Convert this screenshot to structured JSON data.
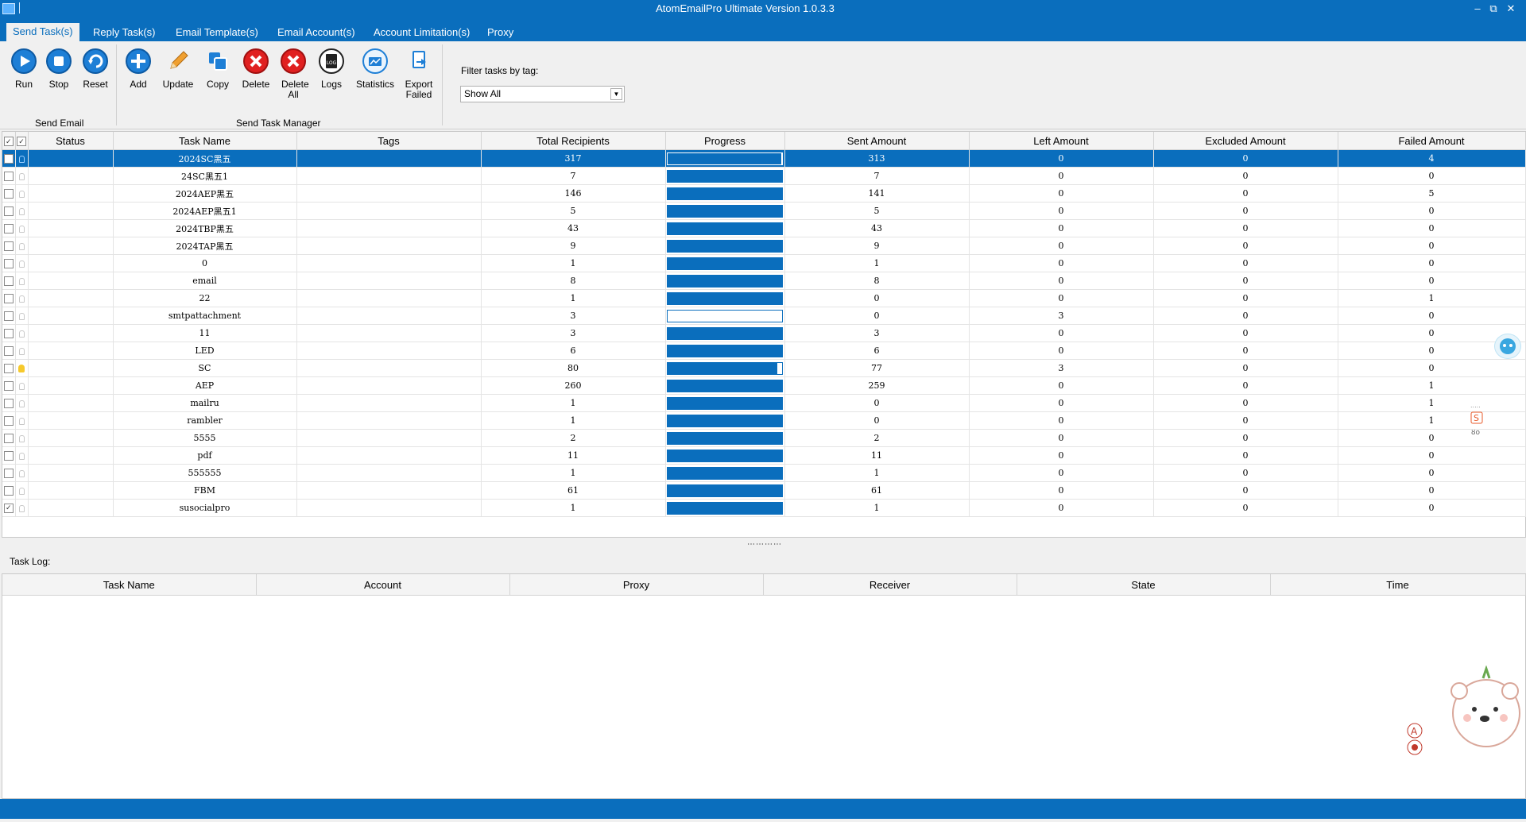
{
  "window": {
    "title": "AtomEmailPro Ultimate Version 1.0.3.3"
  },
  "tabs": [
    "Send Task(s)",
    "Reply Task(s)",
    "Email Template(s)",
    "Email Account(s)",
    "Account Limitation(s)",
    "Proxy"
  ],
  "ribbon": {
    "send_email": {
      "label": "Send Email",
      "buttons": [
        {
          "label": "Run",
          "icon": "play-icon",
          "color": "#1e7fd6"
        },
        {
          "label": "Stop",
          "icon": "stop-icon",
          "color": "#1e7fd6"
        },
        {
          "label": "Reset",
          "icon": "reset-icon",
          "color": "#1e7fd6"
        }
      ]
    },
    "task_manager": {
      "label": "Send Task Manager",
      "buttons": [
        {
          "label": "Add",
          "icon": "add-icon",
          "color": "#1e7fd6"
        },
        {
          "label": "Update",
          "icon": "pencil-icon",
          "color": "#f0a030"
        },
        {
          "label": "Copy",
          "icon": "copy-icon",
          "color": "#1e7fd6"
        },
        {
          "label": "Delete",
          "icon": "delete-icon",
          "color": "#e02020"
        },
        {
          "label": "Delete All",
          "icon": "delete-all-icon",
          "color": "#e02020"
        },
        {
          "label": "Logs",
          "icon": "log-icon",
          "color": "#222222"
        },
        {
          "label": "Statistics",
          "icon": "statistics-icon",
          "color": "#1e7fd6"
        },
        {
          "label": "Export Failed",
          "icon": "export-icon",
          "color": "#1e7fd6"
        }
      ]
    },
    "filter": {
      "label": "Filter tasks by tag:",
      "value": "Show All"
    }
  },
  "grid": {
    "columns": [
      "Status",
      "Task Name",
      "Tags",
      "Total Recipients",
      "Progress",
      "Sent Amount",
      "Left Amount",
      "Excluded Amount",
      "Failed Amount"
    ],
    "rows": [
      {
        "name": "2024SC黑五",
        "tags": "",
        "total": "317",
        "progress": 0.99,
        "sent": "313",
        "left": "0",
        "excluded": "0",
        "failed": "4",
        "selected": true,
        "checked": false,
        "bulb": "dim"
      },
      {
        "name": "24SC黑五1",
        "tags": "",
        "total": "7",
        "progress": 1,
        "sent": "7",
        "left": "0",
        "excluded": "0",
        "failed": "0",
        "selected": false,
        "checked": false,
        "bulb": "dim"
      },
      {
        "name": "2024AEP黑五",
        "tags": "",
        "total": "146",
        "progress": 1,
        "sent": "141",
        "left": "0",
        "excluded": "0",
        "failed": "5",
        "selected": false,
        "checked": false,
        "bulb": "dim"
      },
      {
        "name": "2024AEP黑五1",
        "tags": "",
        "total": "5",
        "progress": 1,
        "sent": "5",
        "left": "0",
        "excluded": "0",
        "failed": "0",
        "selected": false,
        "checked": false,
        "bulb": "dim"
      },
      {
        "name": "2024TBP黑五",
        "tags": "",
        "total": "43",
        "progress": 1,
        "sent": "43",
        "left": "0",
        "excluded": "0",
        "failed": "0",
        "selected": false,
        "checked": false,
        "bulb": "dim"
      },
      {
        "name": "2024TAP黑五",
        "tags": "",
        "total": "9",
        "progress": 1,
        "sent": "9",
        "left": "0",
        "excluded": "0",
        "failed": "0",
        "selected": false,
        "checked": false,
        "bulb": "dim"
      },
      {
        "name": "0",
        "tags": "",
        "total": "1",
        "progress": 1,
        "sent": "1",
        "left": "0",
        "excluded": "0",
        "failed": "0",
        "selected": false,
        "checked": false,
        "bulb": "dim"
      },
      {
        "name": "email",
        "tags": "",
        "total": "8",
        "progress": 1,
        "sent": "8",
        "left": "0",
        "excluded": "0",
        "failed": "0",
        "selected": false,
        "checked": false,
        "bulb": "dim"
      },
      {
        "name": "22",
        "tags": "",
        "total": "1",
        "progress": 1,
        "sent": "0",
        "left": "0",
        "excluded": "0",
        "failed": "1",
        "selected": false,
        "checked": false,
        "bulb": "dim"
      },
      {
        "name": "smtpattachment",
        "tags": "",
        "total": "3",
        "progress": 0,
        "sent": "0",
        "left": "3",
        "excluded": "0",
        "failed": "0",
        "selected": false,
        "checked": false,
        "bulb": "dim"
      },
      {
        "name": "11",
        "tags": "",
        "total": "3",
        "progress": 1,
        "sent": "3",
        "left": "0",
        "excluded": "0",
        "failed": "0",
        "selected": false,
        "checked": false,
        "bulb": "dim"
      },
      {
        "name": "LED",
        "tags": "",
        "total": "6",
        "progress": 1,
        "sent": "6",
        "left": "0",
        "excluded": "0",
        "failed": "0",
        "selected": false,
        "checked": false,
        "bulb": "dim"
      },
      {
        "name": "SC",
        "tags": "",
        "total": "80",
        "progress": 0.96,
        "sent": "77",
        "left": "3",
        "excluded": "0",
        "failed": "0",
        "selected": false,
        "checked": false,
        "bulb": "on"
      },
      {
        "name": "AEP",
        "tags": "",
        "total": "260",
        "progress": 1,
        "sent": "259",
        "left": "0",
        "excluded": "0",
        "failed": "1",
        "selected": false,
        "checked": false,
        "bulb": "dim"
      },
      {
        "name": "mailru",
        "tags": "",
        "total": "1",
        "progress": 1,
        "sent": "0",
        "left": "0",
        "excluded": "0",
        "failed": "1",
        "selected": false,
        "checked": false,
        "bulb": "dim"
      },
      {
        "name": "rambler",
        "tags": "",
        "total": "1",
        "progress": 1,
        "sent": "0",
        "left": "0",
        "excluded": "0",
        "failed": "1",
        "selected": false,
        "checked": false,
        "bulb": "dim"
      },
      {
        "name": "5555",
        "tags": "",
        "total": "2",
        "progress": 1,
        "sent": "2",
        "left": "0",
        "excluded": "0",
        "failed": "0",
        "selected": false,
        "checked": false,
        "bulb": "dim"
      },
      {
        "name": "pdf",
        "tags": "",
        "total": "11",
        "progress": 1,
        "sent": "11",
        "left": "0",
        "excluded": "0",
        "failed": "0",
        "selected": false,
        "checked": false,
        "bulb": "dim"
      },
      {
        "name": "555555",
        "tags": "",
        "total": "1",
        "progress": 1,
        "sent": "1",
        "left": "0",
        "excluded": "0",
        "failed": "0",
        "selected": false,
        "checked": false,
        "bulb": "dim"
      },
      {
        "name": "FBM",
        "tags": "",
        "total": "61",
        "progress": 1,
        "sent": "61",
        "left": "0",
        "excluded": "0",
        "failed": "0",
        "selected": false,
        "checked": false,
        "bulb": "dim"
      },
      {
        "name": "susocialpro",
        "tags": "",
        "total": "1",
        "progress": 1,
        "sent": "1",
        "left": "0",
        "excluded": "0",
        "failed": "0",
        "selected": false,
        "checked": true,
        "bulb": "dim"
      }
    ]
  },
  "task_log": {
    "label": "Task Log:",
    "columns": [
      "Task Name",
      "Account",
      "Proxy",
      "Receiver",
      "State",
      "Time"
    ]
  },
  "colors": {
    "accent": "#0a6ebd",
    "bulb_on": "#f6c92c"
  }
}
